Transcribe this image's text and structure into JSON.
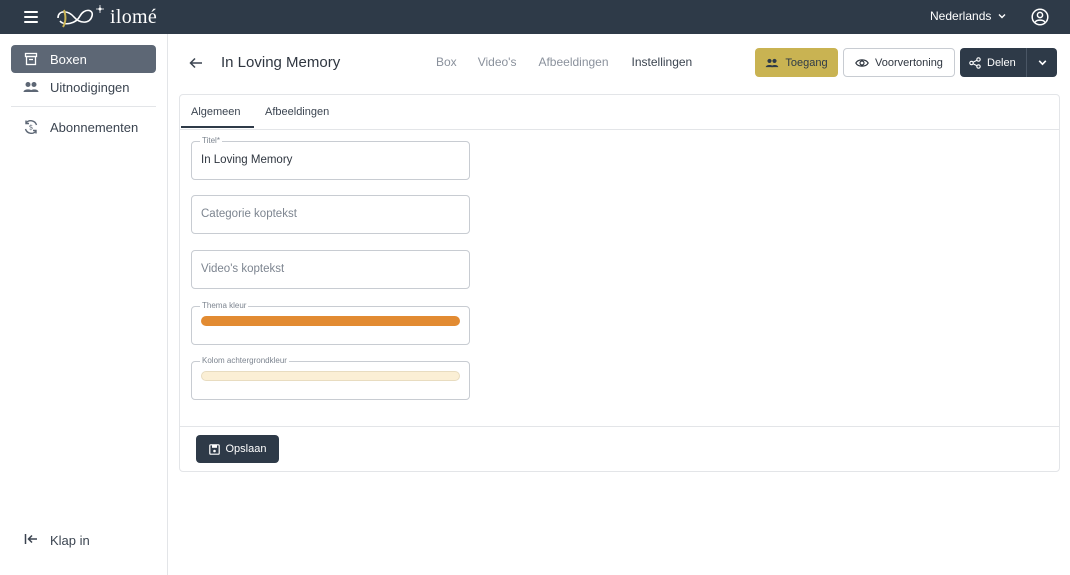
{
  "header": {
    "logo_text": "ilomé",
    "language": "Nederlands"
  },
  "sidebar": {
    "items": [
      {
        "label": "Boxen",
        "icon": "archive-box-icon",
        "active": true
      },
      {
        "label": "Uitnodigingen",
        "icon": "people-icon",
        "active": false
      },
      {
        "label": "Abonnementen",
        "icon": "currency-exchange-icon",
        "active": false
      }
    ],
    "collapse_label": "Klap in"
  },
  "page": {
    "title": "In Loving Memory",
    "nav": [
      "Box",
      "Video's",
      "Afbeeldingen",
      "Instellingen"
    ],
    "buttons": {
      "access": "Toegang",
      "preview": "Voorvertoning",
      "share": "Delen"
    }
  },
  "tabs": [
    "Algemeen",
    "Afbeeldingen"
  ],
  "form": {
    "title_label": "Titel*",
    "title_value": "In Loving Memory",
    "category_placeholder": "Categorie koptekst",
    "videos_placeholder": "Video's koptekst",
    "theme_label": "Thema kleur",
    "theme_color": "#e28b32",
    "column_bg_label": "Kolom achtergrondkleur",
    "column_bg_color": "#fbefd5",
    "save_label": "Opslaan"
  },
  "colors": {
    "topbar": "#2e3a48",
    "accent_gold": "#c9b352",
    "sidebar_active": "#5d6775"
  }
}
